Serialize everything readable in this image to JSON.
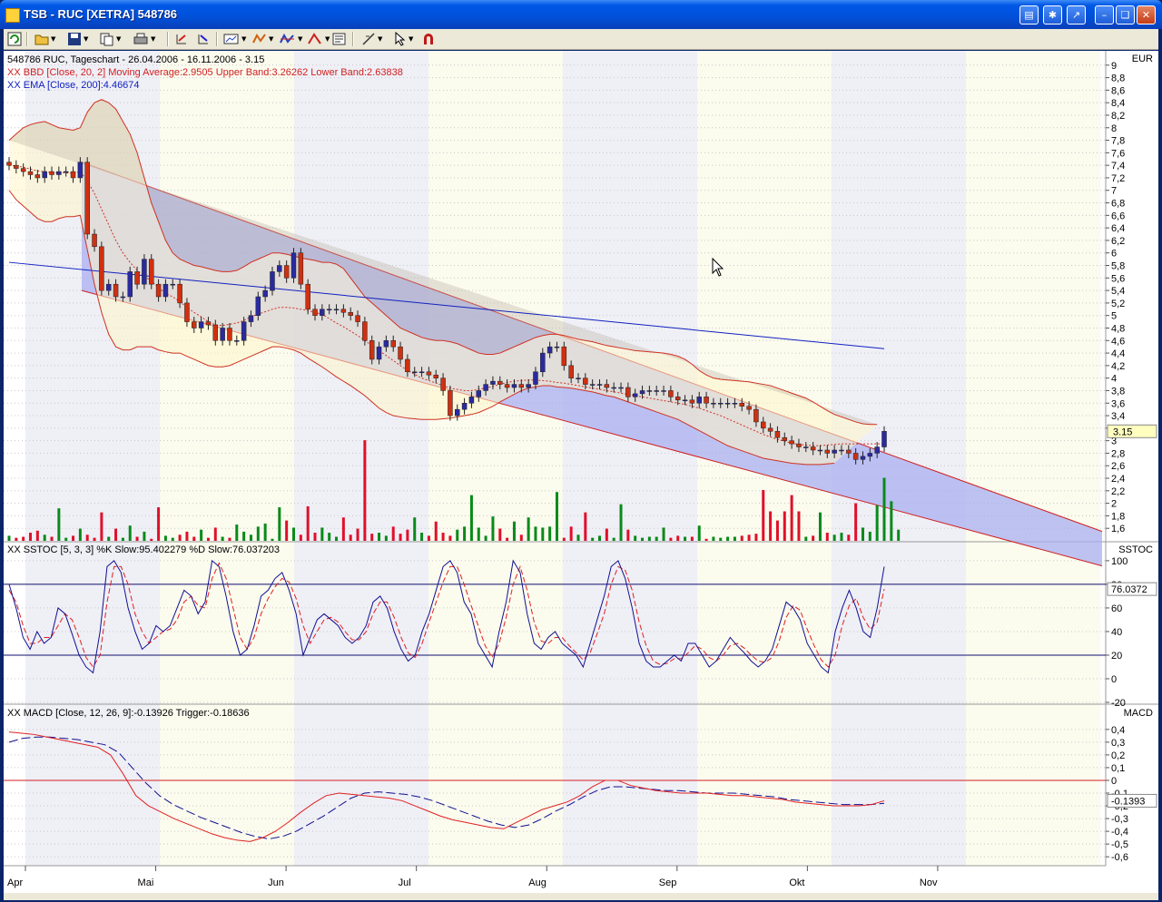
{
  "window": {
    "title": "TSB - RUC [XETRA] 548786",
    "controls": [
      "minimize",
      "restore",
      "close"
    ]
  },
  "toolbar": {
    "buttons": [
      "refresh-icon",
      "open-icon",
      "save-icon",
      "copy-icon",
      "print-icon",
      "undo-icon",
      "redo-icon",
      "chart-type-icon",
      "indicator-icon",
      "study-icon",
      "drawing-icon",
      "properties-icon",
      "line-tool-icon",
      "cursor-icon",
      "magnet-icon"
    ]
  },
  "colors": {
    "candle_up": "#2a2aa0",
    "candle_down": "#d03010",
    "bollinger_band": "#b9b1a2",
    "bollinger_fill_light": "#fff6c8",
    "channel_fill": "#a9aff0",
    "ema": "#1020c0",
    "volume_up": "#0a8a1a",
    "volume_down": "#e0102a",
    "sstoc_k": "#101090",
    "sstoc_d": "#e02020",
    "macd": "#e02020",
    "trigger": "#101090"
  },
  "chart_data": [
    {
      "id": "price",
      "type": "candlestick",
      "title_lines": [
        "548786  RUC, Tageschart - 26.04.2006 - 16.11.2006 - 3.15",
        "XX BBD [Close, 20, 2] Moving Average:2.9505 Upper Band:3.26262 Lower Band:2.63838",
        "XX EMA [Close, 200]:4.46674"
      ],
      "axis_unit": "EUR",
      "ylim": [
        1.4,
        9.2
      ],
      "y_ticks": [
        "9",
        "8,8",
        "8,6",
        "8,4",
        "8,2",
        "8",
        "7,8",
        "7,6",
        "7,4",
        "7,2",
        "7",
        "6,8",
        "6,6",
        "6,4",
        "6,2",
        "6",
        "5,8",
        "5,6",
        "5,4",
        "5,2",
        "5",
        "4,8",
        "4,6",
        "4,4",
        "4,2",
        "4",
        "3,8",
        "3,6",
        "3,4",
        "3,2",
        "3",
        "2,8",
        "2,6",
        "2,4",
        "2,2",
        "2",
        "1,8",
        "1,6"
      ],
      "y_tick_values": [
        9,
        8.8,
        8.6,
        8.4,
        8.2,
        8,
        7.8,
        7.6,
        7.4,
        7.2,
        7,
        6.8,
        6.6,
        6.4,
        6.2,
        6,
        5.8,
        5.6,
        5.4,
        5.2,
        5,
        4.8,
        4.6,
        4.4,
        4.2,
        4,
        3.8,
        3.6,
        3.4,
        3.2,
        3,
        2.8,
        2.6,
        2.4,
        2.2,
        2,
        1.8,
        1.6
      ],
      "last_value": "3.15",
      "x_months": [
        "Apr",
        "Mai",
        "Jun",
        "Jul",
        "Aug",
        "Sep",
        "Okt",
        "Nov"
      ],
      "close_series": [
        7.4,
        7.35,
        7.3,
        7.25,
        7.2,
        7.3,
        7.25,
        7.3,
        7.3,
        7.2,
        7.45,
        6.3,
        6.1,
        5.4,
        5.5,
        5.3,
        5.3,
        5.7,
        5.5,
        5.9,
        5.5,
        5.3,
        5.5,
        5.5,
        5.2,
        4.9,
        4.8,
        4.9,
        4.85,
        4.6,
        4.8,
        4.6,
        4.6,
        4.9,
        5.0,
        5.3,
        5.4,
        5.7,
        5.8,
        5.6,
        6.0,
        5.5,
        5.1,
        5.0,
        5.1,
        5.1,
        5.1,
        5.05,
        5.0,
        4.9,
        4.6,
        4.3,
        4.5,
        4.6,
        4.5,
        4.3,
        4.1,
        4.1,
        4.1,
        4.05,
        4.0,
        3.8,
        3.4,
        3.5,
        3.6,
        3.7,
        3.8,
        3.9,
        3.95,
        3.9,
        3.85,
        3.9,
        3.85,
        3.9,
        4.1,
        4.4,
        4.5,
        4.5,
        4.2,
        4.0,
        4.0,
        3.9,
        3.9,
        3.9,
        3.85,
        3.85,
        3.85,
        3.7,
        3.75,
        3.8,
        3.8,
        3.8,
        3.8,
        3.7,
        3.65,
        3.65,
        3.6,
        3.7,
        3.6,
        3.6,
        3.6,
        3.6,
        3.6,
        3.55,
        3.5,
        3.3,
        3.2,
        3.15,
        3.05,
        3.0,
        2.95,
        2.9,
        2.9,
        2.85,
        2.85,
        2.8,
        2.85,
        2.85,
        2.8,
        2.7,
        2.75,
        2.8,
        2.9,
        3.15
      ],
      "moving_average": [
        7.4,
        7.39,
        7.37,
        7.34,
        7.31,
        7.3,
        7.28,
        7.28,
        7.28,
        7.27,
        7.3,
        7.15,
        6.95,
        6.7,
        6.45,
        6.2,
        6.0,
        5.85,
        5.72,
        5.63,
        5.55,
        5.45,
        5.35,
        5.3,
        5.22,
        5.13,
        5.05,
        4.98,
        4.9,
        4.85,
        4.84,
        4.86,
        4.88,
        4.92,
        4.98,
        5.02,
        5.06,
        5.1,
        5.13,
        5.13,
        5.12,
        5.1,
        5.08,
        5.05,
        5.02,
        4.95,
        4.88,
        4.82,
        4.75,
        4.68,
        4.6,
        4.52,
        4.44,
        4.36,
        4.28,
        4.2,
        4.12,
        4.06,
        4.0,
        3.96,
        3.92,
        3.88,
        3.84,
        3.82,
        3.8,
        3.8,
        3.82,
        3.84,
        3.87,
        3.9,
        3.93,
        3.95,
        3.96,
        3.97,
        3.97,
        3.96,
        3.95,
        3.93,
        3.92,
        3.9,
        3.88,
        3.86,
        3.84,
        3.82,
        3.8,
        3.78,
        3.76,
        3.74,
        3.72,
        3.7,
        3.68,
        3.66,
        3.64,
        3.62,
        3.6,
        3.58,
        3.55,
        3.52,
        3.48,
        3.44,
        3.4,
        3.35,
        3.3,
        3.25,
        3.2,
        3.15,
        3.1,
        3.06,
        3.02,
        2.99,
        2.96,
        2.94,
        2.93,
        2.92,
        2.92,
        2.93,
        2.94,
        2.95,
        2.95,
        2.95,
        2.95,
        2.95,
        2.95,
        2.95
      ],
      "upper_band": [
        7.8,
        7.9,
        8.0,
        8.05,
        8.08,
        8.1,
        8.05,
        8.0,
        7.98,
        7.96,
        8.0,
        8.25,
        8.4,
        8.45,
        8.4,
        8.3,
        8.1,
        7.9,
        7.6,
        7.2,
        6.8,
        6.5,
        6.2,
        6.0,
        5.9,
        5.85,
        5.8,
        5.78,
        5.75,
        5.72,
        5.7,
        5.7,
        5.72,
        5.78,
        5.85,
        5.9,
        5.95,
        6.0,
        6.0,
        5.98,
        5.95,
        5.92,
        5.9,
        5.88,
        5.85,
        5.85,
        5.82,
        5.75,
        5.6,
        5.45,
        5.3,
        5.2,
        5.1,
        5.0,
        4.9,
        4.8,
        4.75,
        4.7,
        4.65,
        4.62,
        4.6,
        4.6,
        4.58,
        4.55,
        4.5,
        4.45,
        4.4,
        4.38,
        4.38,
        4.4,
        4.45,
        4.5,
        4.55,
        4.6,
        4.65,
        4.68,
        4.7,
        4.7,
        4.68,
        4.65,
        4.62,
        4.6,
        4.58,
        4.55,
        4.52,
        4.5,
        4.48,
        4.46,
        4.44,
        4.43,
        4.42,
        4.41,
        4.4,
        4.38,
        4.35,
        4.3,
        4.22,
        4.12,
        4.05,
        4.0,
        3.98,
        3.97,
        3.96,
        3.95,
        3.94,
        3.92,
        3.9,
        3.88,
        3.84,
        3.8,
        3.76,
        3.72,
        3.68,
        3.62,
        3.55,
        3.48,
        3.42,
        3.38,
        3.34,
        3.3,
        3.27,
        3.26,
        3.26
      ],
      "lower_band": [
        7.0,
        6.85,
        6.75,
        6.65,
        6.55,
        6.5,
        6.5,
        6.55,
        6.58,
        6.58,
        6.6,
        6.05,
        5.5,
        5.05,
        4.7,
        4.5,
        4.45,
        4.45,
        4.5,
        4.5,
        4.5,
        4.45,
        4.42,
        4.4,
        4.4,
        4.35,
        4.3,
        4.25,
        4.2,
        4.18,
        4.18,
        4.2,
        4.25,
        4.3,
        4.35,
        4.4,
        4.45,
        4.5,
        4.5,
        4.48,
        4.45,
        4.4,
        4.32,
        4.25,
        4.18,
        4.1,
        4.02,
        3.95,
        3.88,
        3.8,
        3.72,
        3.62,
        3.52,
        3.45,
        3.4,
        3.38,
        3.36,
        3.35,
        3.34,
        3.34,
        3.34,
        3.35,
        3.36,
        3.38,
        3.4,
        3.42,
        3.45,
        3.5,
        3.55,
        3.62,
        3.68,
        3.74,
        3.8,
        3.84,
        3.86,
        3.88,
        3.88,
        3.86,
        3.85,
        3.84,
        3.82,
        3.8,
        3.78,
        3.75,
        3.72,
        3.7,
        3.66,
        3.62,
        3.58,
        3.54,
        3.5,
        3.46,
        3.42,
        3.38,
        3.34,
        3.28,
        3.22,
        3.16,
        3.1,
        3.04,
        2.98,
        2.92,
        2.88,
        2.84,
        2.8,
        2.76,
        2.72,
        2.7,
        2.68,
        2.66,
        2.64,
        2.63,
        2.62,
        2.62,
        2.62,
        2.63,
        2.64
      ],
      "ema_200": {
        "start": 5.85,
        "end": 4.47
      },
      "channel": {
        "upper_start": 7.45,
        "upper_end": 1.55,
        "lower_start": 5.4,
        "lower_end": 1.0
      },
      "volume_ylim": [
        0,
        100
      ],
      "volume": [
        5,
        3,
        4,
        8,
        10,
        6,
        4,
        32,
        3,
        5,
        12,
        6,
        3,
        28,
        4,
        12,
        3,
        15,
        4,
        9,
        2,
        33,
        5,
        3,
        6,
        9,
        4,
        11,
        3,
        13,
        4,
        3,
        16,
        9,
        6,
        14,
        17,
        2,
        33,
        20,
        13,
        6,
        34,
        8,
        13,
        8,
        4,
        23,
        6,
        12,
        99,
        7,
        8,
        5,
        14,
        7,
        11,
        23,
        8,
        5,
        19,
        8,
        5,
        11,
        14,
        45,
        13,
        5,
        24,
        12,
        3,
        19,
        6,
        23,
        14,
        13,
        14,
        48,
        3,
        14,
        6,
        28,
        3,
        5,
        12,
        3,
        36,
        11,
        5,
        3,
        4,
        4,
        13,
        3,
        5,
        4,
        4,
        15,
        2,
        4,
        3,
        4,
        4,
        5,
        6,
        7,
        50,
        29,
        20,
        29,
        45,
        29,
        4,
        5,
        28,
        8,
        6,
        8,
        6,
        37,
        13,
        9,
        35,
        62,
        39,
        11
      ]
    },
    {
      "id": "sstoc",
      "type": "line",
      "title_lines": [
        "XX SSTOC [5, 3, 3] %K Slow:95.402279 %D Slow:76.037203"
      ],
      "axis_unit": "SSTOC",
      "ylim": [
        -20,
        103
      ],
      "y_ticks": [
        "100",
        "80",
        "60",
        "40",
        "20",
        "0",
        "-20"
      ],
      "y_tick_values": [
        100,
        80,
        60,
        40,
        20,
        0,
        -20
      ],
      "last_value": "76.0372",
      "reference_lines": [
        80,
        20
      ],
      "k_slow": [
        80,
        60,
        35,
        25,
        40,
        30,
        35,
        60,
        55,
        38,
        20,
        10,
        5,
        40,
        95,
        100,
        90,
        60,
        40,
        25,
        30,
        45,
        40,
        45,
        60,
        75,
        70,
        55,
        65,
        100,
        95,
        70,
        40,
        20,
        25,
        45,
        70,
        75,
        85,
        90,
        75,
        55,
        20,
        35,
        50,
        55,
        50,
        45,
        35,
        30,
        35,
        45,
        65,
        70,
        60,
        40,
        25,
        15,
        20,
        40,
        55,
        75,
        95,
        100,
        90,
        65,
        55,
        30,
        20,
        10,
        40,
        65,
        100,
        90,
        55,
        30,
        25,
        35,
        40,
        30,
        25,
        20,
        10,
        30,
        50,
        70,
        95,
        100,
        85,
        60,
        30,
        15,
        10,
        10,
        15,
        20,
        15,
        30,
        30,
        20,
        10,
        15,
        25,
        35,
        28,
        22,
        15,
        10,
        15,
        25,
        45,
        65,
        60,
        50,
        30,
        20,
        10,
        5,
        40,
        60,
        75,
        60,
        40,
        35,
        60,
        95
      ],
      "d_slow": [
        75,
        65,
        45,
        30,
        30,
        35,
        35,
        45,
        55,
        50,
        35,
        18,
        10,
        20,
        65,
        95,
        95,
        80,
        55,
        40,
        30,
        35,
        40,
        42,
        50,
        65,
        70,
        62,
        60,
        85,
        98,
        85,
        60,
        35,
        25,
        35,
        55,
        68,
        78,
        85,
        82,
        68,
        45,
        30,
        40,
        50,
        52,
        48,
        40,
        33,
        33,
        40,
        55,
        65,
        65,
        52,
        35,
        22,
        18,
        30,
        48,
        65,
        82,
        95,
        95,
        80,
        62,
        45,
        28,
        18,
        30,
        52,
        80,
        95,
        75,
        48,
        32,
        30,
        35,
        35,
        28,
        22,
        16,
        22,
        38,
        55,
        80,
        95,
        92,
        75,
        48,
        28,
        15,
        12,
        13,
        17,
        17,
        22,
        28,
        25,
        18,
        15,
        20,
        28,
        30,
        26,
        20,
        15,
        14,
        18,
        32,
        52,
        62,
        58,
        42,
        28,
        16,
        10,
        20,
        45,
        62,
        68,
        52,
        42,
        48,
        76
      ]
    },
    {
      "id": "macd",
      "type": "line",
      "title_lines": [
        "XX MACD [Close, 12, 26, 9]:-0.13926 Trigger:-0.18636"
      ],
      "axis_unit": "MACD",
      "ylim": [
        -0.67,
        0.47
      ],
      "y_ticks": [
        "0,4",
        "0,3",
        "0,2",
        "0,1",
        "0",
        "-0,1",
        "-0,2",
        "-0,3",
        "-0,4",
        "-0,5",
        "-0,6"
      ],
      "y_tick_values": [
        0.4,
        0.3,
        0.2,
        0.1,
        0,
        -0.1,
        -0.2,
        -0.3,
        -0.4,
        -0.5,
        -0.6
      ],
      "last_value": "-0.1393",
      "reference_lines": [
        0
      ],
      "macd": [
        0.38,
        0.37,
        0.36,
        0.34,
        0.32,
        0.3,
        0.28,
        0.26,
        0.2,
        0.05,
        -0.12,
        -0.2,
        -0.25,
        -0.3,
        -0.34,
        -0.38,
        -0.42,
        -0.45,
        -0.47,
        -0.48,
        -0.45,
        -0.4,
        -0.33,
        -0.25,
        -0.18,
        -0.12,
        -0.1,
        -0.11,
        -0.12,
        -0.13,
        -0.14,
        -0.16,
        -0.2,
        -0.24,
        -0.28,
        -0.31,
        -0.33,
        -0.35,
        -0.37,
        -0.38,
        -0.33,
        -0.28,
        -0.23,
        -0.2,
        -0.17,
        -0.12,
        -0.05,
        0.0,
        0.0,
        -0.04,
        -0.06,
        -0.08,
        -0.09,
        -0.1,
        -0.1,
        -0.1,
        -0.11,
        -0.12,
        -0.12,
        -0.13,
        -0.14,
        -0.15,
        -0.17,
        -0.18,
        -0.19,
        -0.2,
        -0.2,
        -0.2,
        -0.19,
        -0.16
      ],
      "trigger": [
        0.3,
        0.33,
        0.34,
        0.34,
        0.33,
        0.32,
        0.3,
        0.28,
        0.22,
        0.1,
        -0.02,
        -0.12,
        -0.19,
        -0.24,
        -0.29,
        -0.33,
        -0.37,
        -0.41,
        -0.44,
        -0.46,
        -0.44,
        -0.4,
        -0.34,
        -0.28,
        -0.21,
        -0.14,
        -0.1,
        -0.09,
        -0.1,
        -0.11,
        -0.13,
        -0.16,
        -0.2,
        -0.24,
        -0.28,
        -0.32,
        -0.35,
        -0.37,
        -0.35,
        -0.3,
        -0.24,
        -0.19,
        -0.13,
        -0.08,
        -0.05,
        -0.05,
        -0.06,
        -0.07,
        -0.08,
        -0.08,
        -0.09,
        -0.1,
        -0.1,
        -0.1,
        -0.11,
        -0.12,
        -0.13,
        -0.15,
        -0.16,
        -0.17,
        -0.18,
        -0.19,
        -0.19,
        -0.19,
        -0.18
      ]
    }
  ]
}
